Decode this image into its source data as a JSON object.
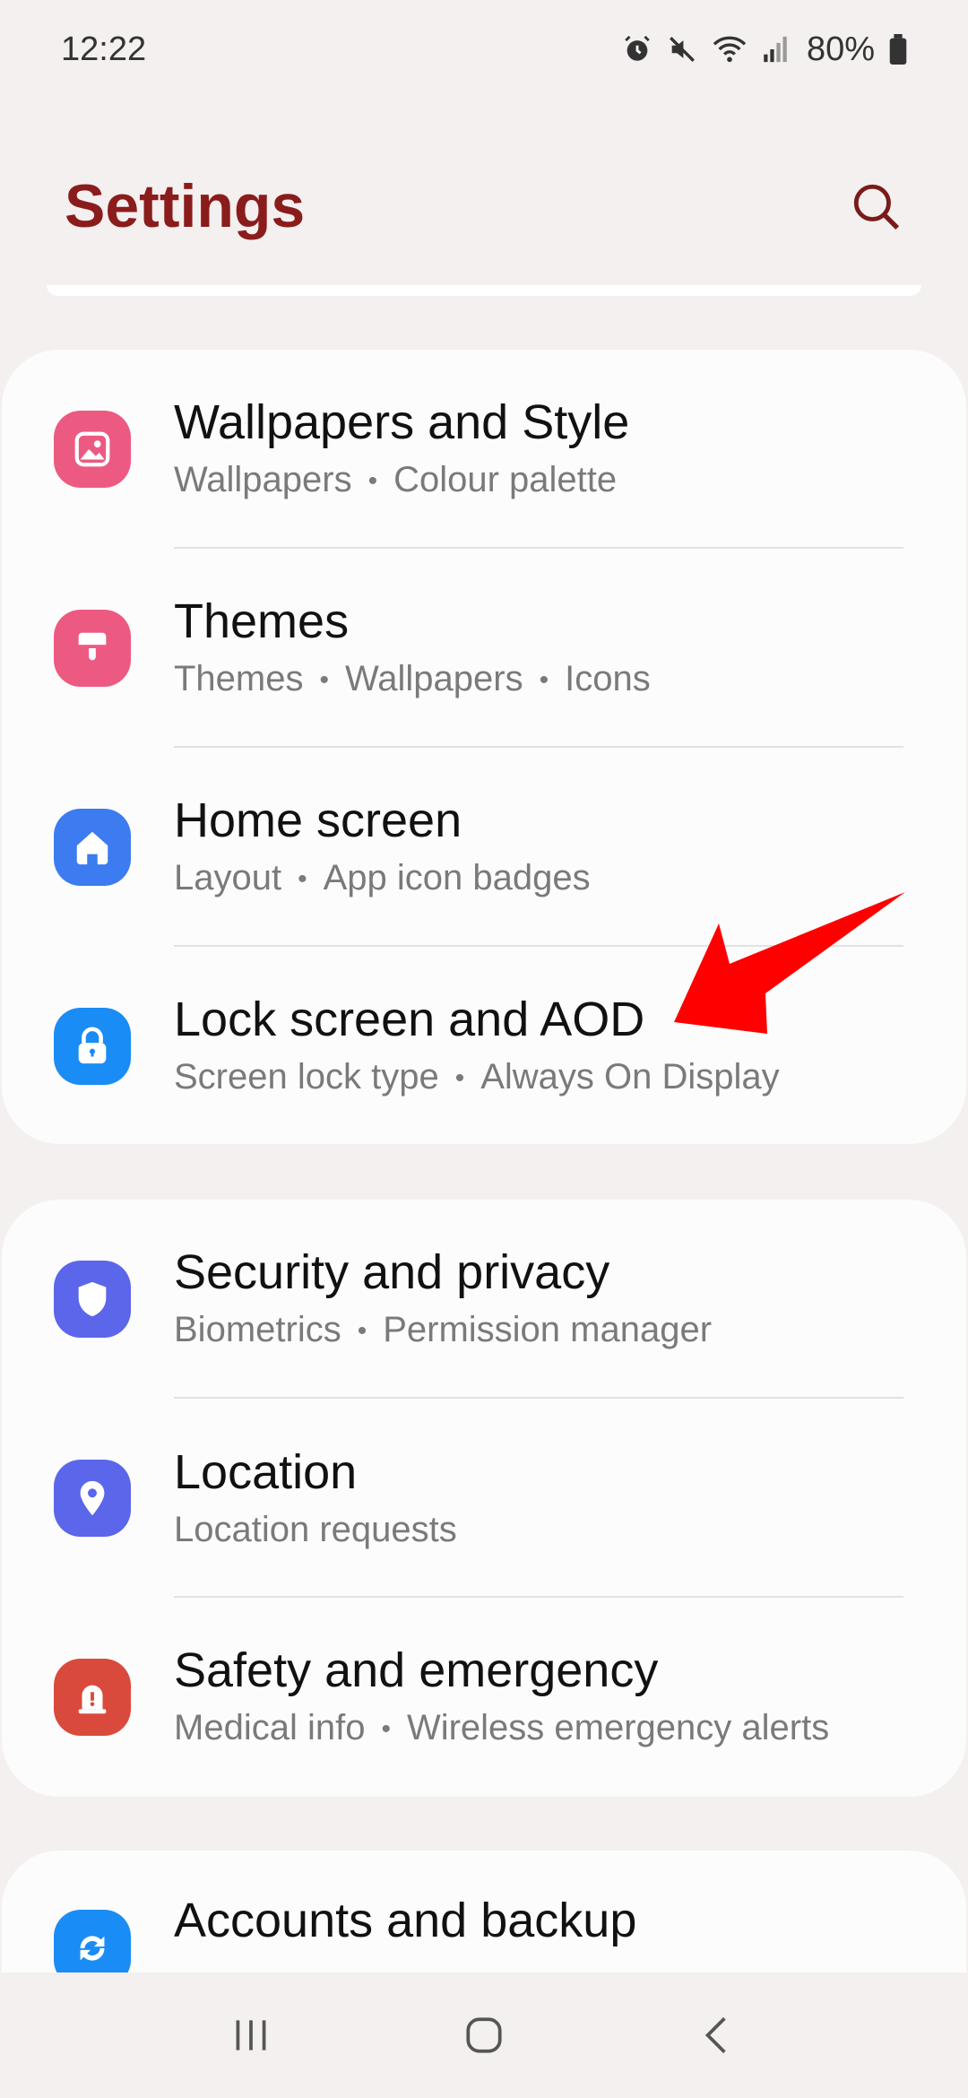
{
  "status_bar": {
    "time": "12:22",
    "battery": "80%",
    "icons": [
      "alarm-icon",
      "mute-icon",
      "wifi-icon",
      "signal-icon",
      "battery-icon"
    ]
  },
  "header": {
    "title": "Settings",
    "search_icon": "search-icon"
  },
  "cards": [
    {
      "items": [
        {
          "title": "Wallpapers and Style",
          "subtitle": [
            "Wallpapers",
            "Colour palette"
          ],
          "icon": "wallpaper-icon",
          "color": "#ec5a82"
        },
        {
          "title": "Themes",
          "subtitle": [
            "Themes",
            "Wallpapers",
            "Icons"
          ],
          "icon": "paintbrush-icon",
          "color": "#ec5a82"
        },
        {
          "title": "Home screen",
          "subtitle": [
            "Layout",
            "App icon badges"
          ],
          "icon": "home-icon",
          "color": "#3c7bf0"
        },
        {
          "title": "Lock screen and AOD",
          "subtitle": [
            "Screen lock type",
            "Always On Display"
          ],
          "icon": "lock-icon",
          "color": "#1a8cf5"
        }
      ]
    },
    {
      "items": [
        {
          "title": "Security and privacy",
          "subtitle": [
            "Biometrics",
            "Permission manager"
          ],
          "icon": "shield-icon",
          "color": "#5b66ea"
        },
        {
          "title": "Location",
          "subtitle": [
            "Location requests"
          ],
          "icon": "location-pin-icon",
          "color": "#5b66ea"
        },
        {
          "title": "Safety and emergency",
          "subtitle": [
            "Medical info",
            "Wireless emergency alerts"
          ],
          "icon": "emergency-icon",
          "color": "#d94a3c"
        }
      ]
    },
    {
      "items": [
        {
          "title": "Accounts and backup",
          "subtitle": [],
          "icon": "sync-icon",
          "color": "#1a8cf5"
        }
      ]
    }
  ],
  "nav_bar": {
    "recents_icon": "recents-icon",
    "home_icon": "home-button-icon",
    "back_icon": "back-icon"
  },
  "colors": {
    "background": "#f3f0ef",
    "title": "#8b1c1c",
    "annotation_arrow": "#ff0000"
  }
}
